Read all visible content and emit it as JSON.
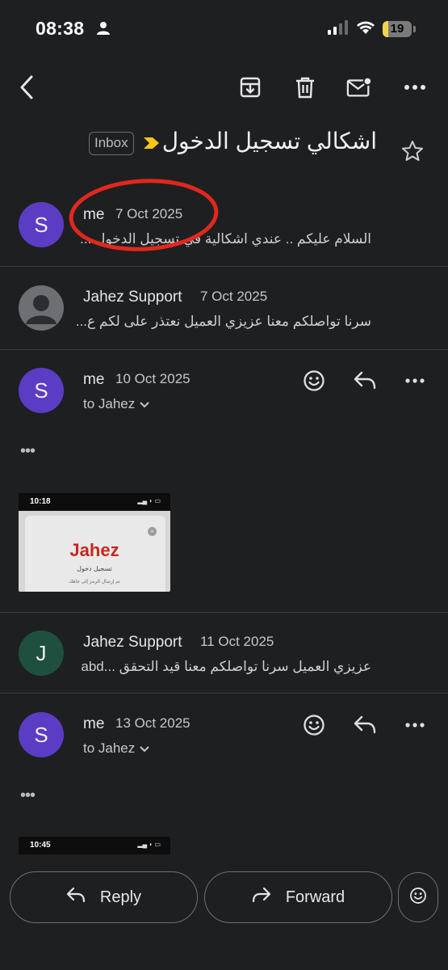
{
  "status_bar": {
    "time": "08:38",
    "battery": "19",
    "battery_level": 0.19
  },
  "toolbar": {
    "icons": [
      "back-arrow-icon",
      "archive-icon",
      "trash-icon",
      "mark-unread-icon",
      "more-icon"
    ]
  },
  "subject": {
    "title": "اشكالي تسجيل الدخول",
    "label": "Inbox"
  },
  "messages": [
    {
      "sender": "me",
      "date": "7 Oct 2025",
      "avatar": "S",
      "snippet": "السلام عليكم .. عندي اشكالية في تسجيل الدخول ..."
    },
    {
      "sender": "Jahez Support",
      "date": "7 Oct 2025",
      "snippet": "سرنا تواصلكم معنا عزيزي العميل نعتذر على لكم ع..."
    },
    {
      "sender": "me",
      "date": "10 Oct 2025",
      "avatar": "S",
      "to": "to Jahez",
      "dots": "•••",
      "thumbnail": {
        "time": "10:18",
        "logo": "Jahez",
        "line1": "تسجيل دخول",
        "line2": "تم إرسال الرمز إلى جاهك"
      }
    },
    {
      "sender": "Jahez Support",
      "date": "11 Oct 2025",
      "avatar": "J",
      "snippet": "عزيزي العميل سرنا تواصلكم معنا قيد التحقق ...abd"
    },
    {
      "sender": "me",
      "date": "13 Oct 2025",
      "avatar": "S",
      "to": "to Jahez",
      "dots": "•••",
      "thumbnail": {
        "time": "10:45"
      }
    }
  ],
  "actions": {
    "reply": "Reply",
    "forward": "Forward"
  },
  "colors": {
    "background": "#1e1f21",
    "avatar_purple": "#5b3cc4",
    "avatar_green": "#1f4f3f",
    "annotation_red": "#e0281e",
    "label_chevron": "#f5c518"
  }
}
